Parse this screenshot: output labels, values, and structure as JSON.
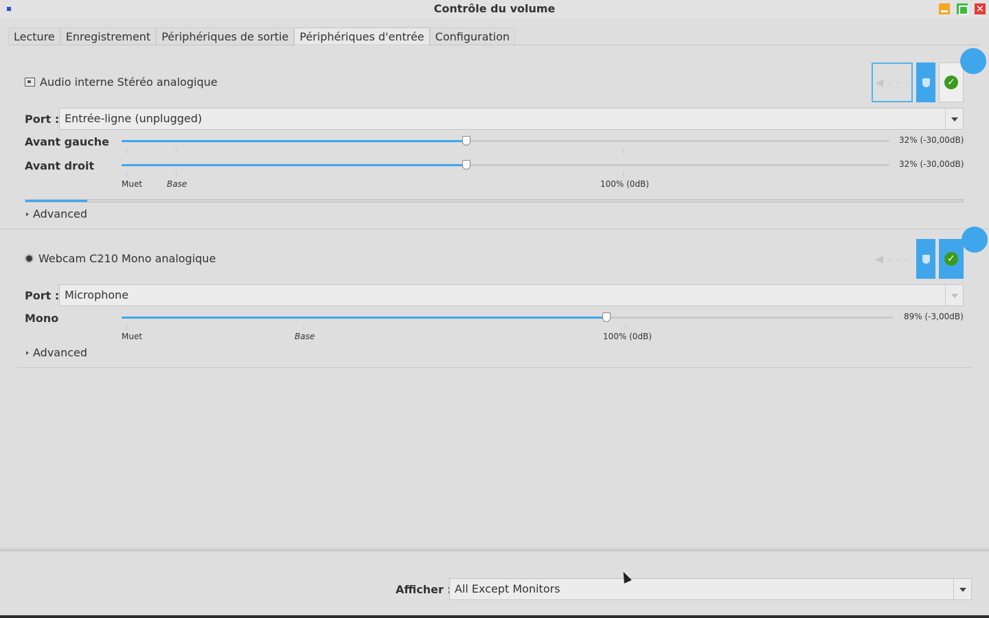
{
  "window": {
    "title": "Contrôle du volume",
    "close_glyph": "✕"
  },
  "tabs": [
    {
      "label": "Lecture",
      "active": false
    },
    {
      "label": "Enregistrement",
      "active": false
    },
    {
      "label": "Périphériques de sortie",
      "active": false
    },
    {
      "label": "Périphériques d'entrée",
      "active": true
    },
    {
      "label": "Configuration",
      "active": false
    }
  ],
  "devices": [
    {
      "name": "Audio interne Stéréo analogique",
      "icon": "sound-card-icon",
      "port_label": "Port :",
      "port_value": "Entrée-ligne (unplugged)",
      "channels": [
        {
          "label": "Avant gauche",
          "percent": 32,
          "value_text": "32% (-30,00dB)"
        },
        {
          "label": "Avant droit",
          "percent": 32,
          "value_text": "32% (-30,00dB)"
        }
      ],
      "scale_marks": {
        "mute": "Muet",
        "base": "Base",
        "full": "100% (0dB)"
      },
      "peak_level": 0.066,
      "advanced_label": "Advanced",
      "mute_glyph": "◀ - - -",
      "check_glyph": "✓"
    },
    {
      "name": "Webcam C210 Mono analogique",
      "icon": "webcam-icon",
      "port_label": "Port :",
      "port_value": "Microphone",
      "channels": [
        {
          "label": "Mono",
          "percent": 89,
          "value_text": "89% (-3,00dB)"
        }
      ],
      "scale_marks": {
        "mute": "Muet",
        "base": "Base",
        "full": "100% (0dB)"
      },
      "advanced_label": "Advanced",
      "mute_glyph": "◀ - - -",
      "check_glyph": "✓"
    }
  ],
  "footer": {
    "show_label": "Afficher :",
    "show_value": "All Except Monitors"
  },
  "colors": {
    "accent": "#3fa6ec",
    "check_green": "#3e9a1e",
    "minimize": "#f5a623",
    "maximize": "#3dbb3d",
    "close": "#e53935"
  }
}
